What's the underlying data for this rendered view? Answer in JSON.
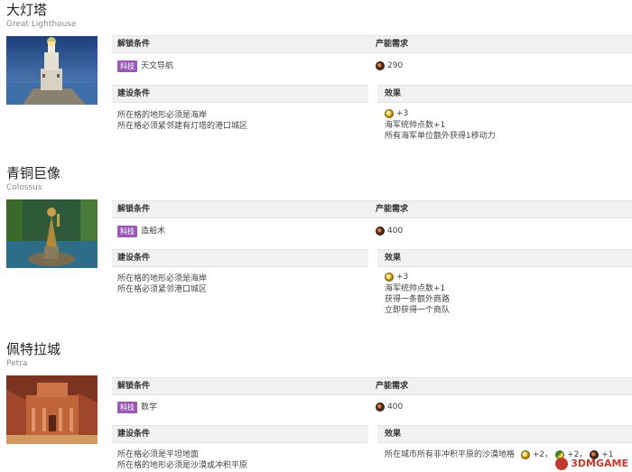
{
  "labels": {
    "unlock": "解锁条件",
    "production": "产能需求",
    "build": "建设条件",
    "effect": "效果"
  },
  "colors": {
    "badge_bg": "#9b59b6",
    "header_bg": "#f1f1f1",
    "watermark": "#c0392b"
  },
  "wonders": [
    {
      "title": "大灯塔",
      "subtitle": "Great Lighthouse",
      "image_icon": "lighthouse-image",
      "unlock_badge": "科技",
      "unlock_tech": "天文导航",
      "cost_icon": "production-icon",
      "cost": "290",
      "build_lines": [
        "所在格的地形必须是海岸",
        "所在格必须紧邻建有灯塔的港口城区"
      ],
      "effect_icon": "gold-icon",
      "effect_gold": "+3",
      "effect_lines": [
        "海军统帅点数+1",
        "所有海军单位额外获得1移动力"
      ]
    },
    {
      "title": "青铜巨像",
      "subtitle": "Colossus",
      "image_icon": "colossus-image",
      "unlock_badge": "科技",
      "unlock_tech": "造船术",
      "cost_icon": "production-icon",
      "cost": "400",
      "build_lines": [
        "所在格的地形必须是海岸",
        "所在格必须紧邻港口城区"
      ],
      "effect_icon": "gold-icon",
      "effect_gold": "+3",
      "effect_lines": [
        "海军统帅点数+1",
        "获得一条额外商路",
        "立即获得一个商队"
      ]
    },
    {
      "title": "佩特拉城",
      "subtitle": "Petra",
      "image_icon": "petra-image",
      "unlock_badge": "科技",
      "unlock_tech": "数学",
      "cost_icon": "production-icon",
      "cost": "400",
      "build_lines": [
        "所在格必须是平坦地面",
        "所在格的地形必须是沙漠或冲积平原"
      ],
      "effect_text": "所在城市所有非冲积平原的沙漠地格",
      "effect_yields": [
        {
          "icon": "gold-icon",
          "value": "+2"
        },
        {
          "icon": "faith-icon",
          "value": "+2"
        },
        {
          "icon": "production-icon",
          "value": "+1"
        }
      ]
    }
  ],
  "watermark": "3DMGAME"
}
